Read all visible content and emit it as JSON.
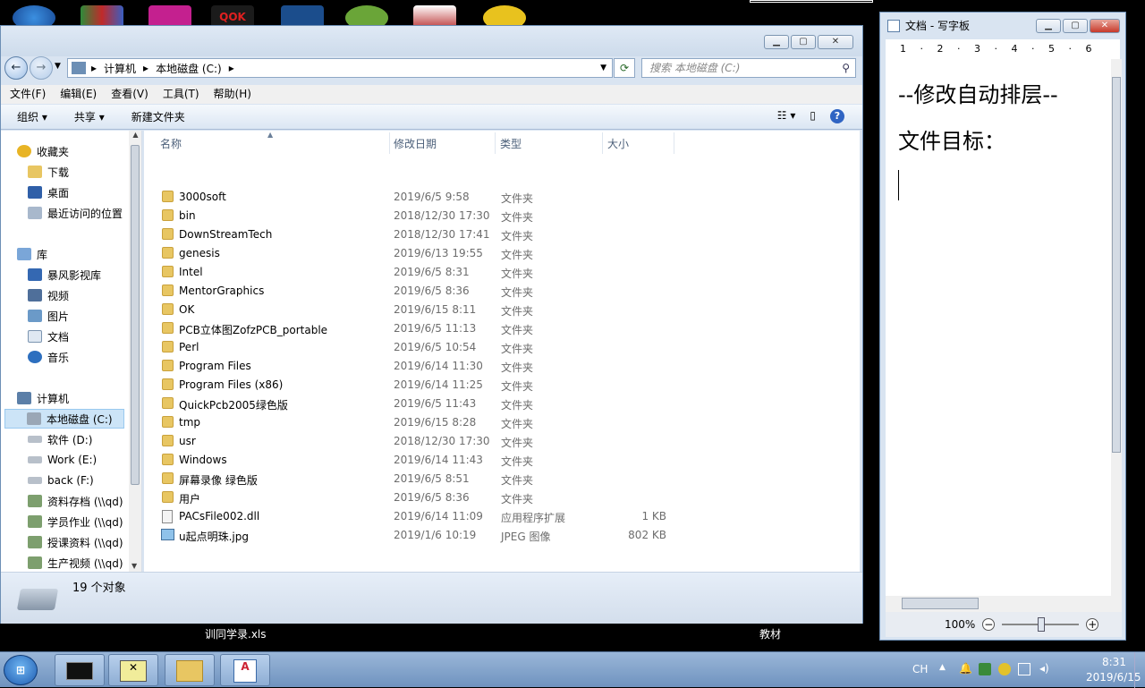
{
  "desktop": {
    "labels": [
      "训同学录.xls",
      "教材"
    ]
  },
  "explorer": {
    "address": {
      "crumbs": [
        "计算机",
        "本地磁盘 (C:)"
      ],
      "search_placeholder": "搜索 本地磁盘 (C:)"
    },
    "menu": [
      "文件(F)",
      "编辑(E)",
      "查看(V)",
      "工具(T)",
      "帮助(H)"
    ],
    "toolbar": {
      "organize": "组织",
      "share": "共享",
      "new_folder": "新建文件夹"
    },
    "nav": {
      "favorites": "收藏夹",
      "downloads": "下载",
      "desktop": "桌面",
      "recent": "最近访问的位置",
      "libraries": "库",
      "storm": "暴风影视库",
      "videos": "视频",
      "pictures": "图片",
      "documents": "文档",
      "music": "音乐",
      "computer": "计算机",
      "drive_c": "本地磁盘 (C:)",
      "drive_d": "软件 (D:)",
      "drive_e": "Work (E:)",
      "drive_f": "back (F:)",
      "net1": "资料存档 (\\\\qd)",
      "net2": "学员作业 (\\\\qd)",
      "net3": "授课资料 (\\\\qd)",
      "net4": "生产视频 (\\\\qd)"
    },
    "columns": {
      "name": "名称",
      "modified": "修改日期",
      "type": "类型",
      "size": "大小"
    },
    "files": [
      {
        "name": "3000soft",
        "date": "2019/6/5 9:58",
        "type": "文件夹",
        "size": "",
        "icon": "folder"
      },
      {
        "name": "bin",
        "date": "2018/12/30 17:30",
        "type": "文件夹",
        "size": "",
        "icon": "folder"
      },
      {
        "name": "DownStreamTech",
        "date": "2018/12/30 17:41",
        "type": "文件夹",
        "size": "",
        "icon": "folder"
      },
      {
        "name": "genesis",
        "date": "2019/6/13 19:55",
        "type": "文件夹",
        "size": "",
        "icon": "folder"
      },
      {
        "name": "Intel",
        "date": "2019/6/5 8:31",
        "type": "文件夹",
        "size": "",
        "icon": "folder"
      },
      {
        "name": "MentorGraphics",
        "date": "2019/6/5 8:36",
        "type": "文件夹",
        "size": "",
        "icon": "folder"
      },
      {
        "name": "OK",
        "date": "2019/6/15 8:11",
        "type": "文件夹",
        "size": "",
        "icon": "folder"
      },
      {
        "name": "PCB立体图ZofzPCB_portable",
        "date": "2019/6/5 11:13",
        "type": "文件夹",
        "size": "",
        "icon": "folder"
      },
      {
        "name": "Perl",
        "date": "2019/6/5 10:54",
        "type": "文件夹",
        "size": "",
        "icon": "folder"
      },
      {
        "name": "Program Files",
        "date": "2019/6/14 11:30",
        "type": "文件夹",
        "size": "",
        "icon": "folder"
      },
      {
        "name": "Program Files (x86)",
        "date": "2019/6/14 11:25",
        "type": "文件夹",
        "size": "",
        "icon": "folder"
      },
      {
        "name": "QuickPcb2005绿色版",
        "date": "2019/6/5 11:43",
        "type": "文件夹",
        "size": "",
        "icon": "folder"
      },
      {
        "name": "tmp",
        "date": "2019/6/15 8:28",
        "type": "文件夹",
        "size": "",
        "icon": "folder"
      },
      {
        "name": "usr",
        "date": "2018/12/30 17:30",
        "type": "文件夹",
        "size": "",
        "icon": "folder"
      },
      {
        "name": "Windows",
        "date": "2019/6/14 11:43",
        "type": "文件夹",
        "size": "",
        "icon": "folder"
      },
      {
        "name": "屏幕录像 绿色版",
        "date": "2019/6/5 8:51",
        "type": "文件夹",
        "size": "",
        "icon": "folder"
      },
      {
        "name": "用户",
        "date": "2019/6/5 8:36",
        "type": "文件夹",
        "size": "",
        "icon": "folder"
      },
      {
        "name": "PACsFile002.dll",
        "date": "2019/6/14 11:09",
        "type": "应用程序扩展",
        "size": "1 KB",
        "icon": "dll-file"
      },
      {
        "name": "u起点明珠.jpg",
        "date": "2019/1/6 10:19",
        "type": "JPEG 图像",
        "size": "802 KB",
        "icon": "image-file"
      }
    ],
    "status": "19 个对象"
  },
  "wordpad": {
    "title": "文档 - 写字板",
    "ruler": "1 · 2 · 3 · 4 · 5 · 6",
    "lines": [
      "--修改自动排层--",
      "文件目标："
    ],
    "zoom": "100%"
  },
  "tray": {
    "lang": "CH",
    "time": "8:31",
    "date": "2019/6/15"
  }
}
